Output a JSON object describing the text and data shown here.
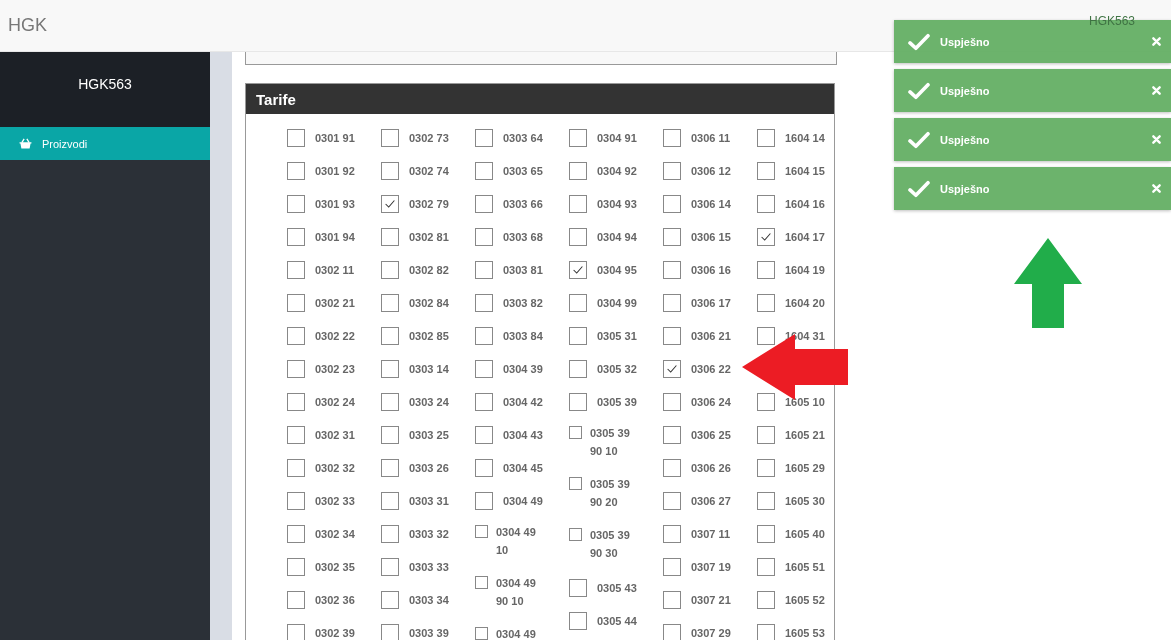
{
  "header": {
    "brand": "HGK",
    "user_menu": "HGK563"
  },
  "sidebar": {
    "user": "HGK563",
    "items": [
      {
        "label": "Proizvodi",
        "selected": true
      }
    ]
  },
  "panel": {
    "title": "Tarife",
    "columns": [
      [
        {
          "label": "0301 91",
          "checked": false,
          "kind": "normal"
        },
        {
          "label": "0301 92",
          "checked": false,
          "kind": "normal"
        },
        {
          "label": "0301 93",
          "checked": false,
          "kind": "normal"
        },
        {
          "label": "0301 94",
          "checked": false,
          "kind": "normal"
        },
        {
          "label": "0302 11",
          "checked": false,
          "kind": "normal"
        },
        {
          "label": "0302 21",
          "checked": false,
          "kind": "normal"
        },
        {
          "label": "0302 22",
          "checked": false,
          "kind": "normal"
        },
        {
          "label": "0302 23",
          "checked": false,
          "kind": "normal"
        },
        {
          "label": "0302 24",
          "checked": false,
          "kind": "normal"
        },
        {
          "label": "0302 31",
          "checked": false,
          "kind": "normal"
        },
        {
          "label": "0302 32",
          "checked": false,
          "kind": "normal"
        },
        {
          "label": "0302 33",
          "checked": false,
          "kind": "normal"
        },
        {
          "label": "0302 34",
          "checked": false,
          "kind": "normal"
        },
        {
          "label": "0302 35",
          "checked": false,
          "kind": "normal"
        },
        {
          "label": "0302 36",
          "checked": false,
          "kind": "normal"
        },
        {
          "label": "0302 39",
          "checked": false,
          "kind": "normal"
        }
      ],
      [
        {
          "label": "0302 73",
          "checked": false,
          "kind": "normal"
        },
        {
          "label": "0302 74",
          "checked": false,
          "kind": "normal"
        },
        {
          "label": "0302 79",
          "checked": true,
          "kind": "normal"
        },
        {
          "label": "0302 81",
          "checked": false,
          "kind": "normal"
        },
        {
          "label": "0302 82",
          "checked": false,
          "kind": "normal"
        },
        {
          "label": "0302 84",
          "checked": false,
          "kind": "normal"
        },
        {
          "label": "0302 85",
          "checked": false,
          "kind": "normal"
        },
        {
          "label": "0303 14",
          "checked": false,
          "kind": "normal"
        },
        {
          "label": "0303 24",
          "checked": false,
          "kind": "normal"
        },
        {
          "label": "0303 25",
          "checked": false,
          "kind": "normal"
        },
        {
          "label": "0303 26",
          "checked": false,
          "kind": "normal"
        },
        {
          "label": "0303 31",
          "checked": false,
          "kind": "normal"
        },
        {
          "label": "0303 32",
          "checked": false,
          "kind": "normal"
        },
        {
          "label": "0303 33",
          "checked": false,
          "kind": "normal"
        },
        {
          "label": "0303 34",
          "checked": false,
          "kind": "normal"
        },
        {
          "label": "0303 39",
          "checked": false,
          "kind": "normal"
        }
      ],
      [
        {
          "label": "0303 64",
          "checked": false,
          "kind": "normal"
        },
        {
          "label": "0303 65",
          "checked": false,
          "kind": "normal"
        },
        {
          "label": "0303 66",
          "checked": false,
          "kind": "normal"
        },
        {
          "label": "0303 68",
          "checked": false,
          "kind": "normal"
        },
        {
          "label": "0303 81",
          "checked": false,
          "kind": "normal"
        },
        {
          "label": "0303 82",
          "checked": false,
          "kind": "normal"
        },
        {
          "label": "0303 84",
          "checked": false,
          "kind": "normal"
        },
        {
          "label": "0304 39",
          "checked": false,
          "kind": "normal"
        },
        {
          "label": "0304 42",
          "checked": false,
          "kind": "normal"
        },
        {
          "label": "0304 43",
          "checked": false,
          "kind": "normal"
        },
        {
          "label": "0304 45",
          "checked": false,
          "kind": "normal"
        },
        {
          "label": "0304 49",
          "checked": false,
          "kind": "normal"
        },
        {
          "label": "0304 49 10",
          "checked": false,
          "kind": "wrapped"
        },
        {
          "label": "0304 49 90 10",
          "checked": false,
          "kind": "wrapped"
        },
        {
          "label": "0304 49",
          "checked": false,
          "kind": "wrapped"
        }
      ],
      [
        {
          "label": "0304 91",
          "checked": false,
          "kind": "normal"
        },
        {
          "label": "0304 92",
          "checked": false,
          "kind": "normal"
        },
        {
          "label": "0304 93",
          "checked": false,
          "kind": "normal"
        },
        {
          "label": "0304 94",
          "checked": false,
          "kind": "normal"
        },
        {
          "label": "0304 95",
          "checked": true,
          "kind": "normal"
        },
        {
          "label": "0304 99",
          "checked": false,
          "kind": "normal"
        },
        {
          "label": "0305 31",
          "checked": false,
          "kind": "normal"
        },
        {
          "label": "0305 32",
          "checked": false,
          "kind": "normal"
        },
        {
          "label": "0305 39",
          "checked": false,
          "kind": "normal"
        },
        {
          "label": "0305 39 90 10",
          "checked": false,
          "kind": "wrapped"
        },
        {
          "label": "0305 39 90 20",
          "checked": false,
          "kind": "wrapped"
        },
        {
          "label": "0305 39 90 30",
          "checked": false,
          "kind": "wrapped"
        },
        {
          "label": "0305 43",
          "checked": false,
          "kind": "normal"
        },
        {
          "label": "0305 44",
          "checked": false,
          "kind": "normal"
        }
      ],
      [
        {
          "label": "0306 11",
          "checked": false,
          "kind": "normal"
        },
        {
          "label": "0306 12",
          "checked": false,
          "kind": "normal"
        },
        {
          "label": "0306 14",
          "checked": false,
          "kind": "normal"
        },
        {
          "label": "0306 15",
          "checked": false,
          "kind": "normal"
        },
        {
          "label": "0306 16",
          "checked": false,
          "kind": "normal"
        },
        {
          "label": "0306 17",
          "checked": false,
          "kind": "normal"
        },
        {
          "label": "0306 21",
          "checked": false,
          "kind": "normal"
        },
        {
          "label": "0306 22",
          "checked": true,
          "kind": "normal"
        },
        {
          "label": "0306 24",
          "checked": false,
          "kind": "normal"
        },
        {
          "label": "0306 25",
          "checked": false,
          "kind": "normal"
        },
        {
          "label": "0306 26",
          "checked": false,
          "kind": "normal"
        },
        {
          "label": "0306 27",
          "checked": false,
          "kind": "normal"
        },
        {
          "label": "0307 11",
          "checked": false,
          "kind": "normal"
        },
        {
          "label": "0307 19",
          "checked": false,
          "kind": "normal"
        },
        {
          "label": "0307 21",
          "checked": false,
          "kind": "normal"
        },
        {
          "label": "0307 29",
          "checked": false,
          "kind": "normal"
        }
      ],
      [
        {
          "label": "1604 14",
          "checked": false,
          "kind": "normal"
        },
        {
          "label": "1604 15",
          "checked": false,
          "kind": "normal"
        },
        {
          "label": "1604 16",
          "checked": false,
          "kind": "normal"
        },
        {
          "label": "1604 17",
          "checked": true,
          "kind": "normal"
        },
        {
          "label": "1604 19",
          "checked": false,
          "kind": "normal"
        },
        {
          "label": "1604 20",
          "checked": false,
          "kind": "normal"
        },
        {
          "label": "1604 31",
          "checked": false,
          "kind": "normal"
        },
        {
          "kind": "covered"
        },
        {
          "label": "1605 10",
          "checked": false,
          "kind": "normal"
        },
        {
          "label": "1605 21",
          "checked": false,
          "kind": "normal"
        },
        {
          "label": "1605 29",
          "checked": false,
          "kind": "normal"
        },
        {
          "label": "1605 30",
          "checked": false,
          "kind": "normal"
        },
        {
          "label": "1605 40",
          "checked": false,
          "kind": "normal"
        },
        {
          "label": "1605 51",
          "checked": false,
          "kind": "normal"
        },
        {
          "label": "1605 52",
          "checked": false,
          "kind": "normal"
        },
        {
          "label": "1605 53",
          "checked": false,
          "kind": "normal"
        }
      ]
    ]
  },
  "toasts": [
    {
      "message": "Uspješno"
    },
    {
      "message": "Uspješno"
    },
    {
      "message": "Uspješno"
    },
    {
      "message": "Uspješno"
    }
  ]
}
